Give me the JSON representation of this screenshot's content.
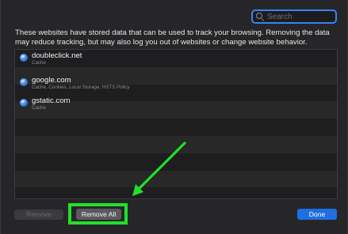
{
  "search": {
    "placeholder": "Search",
    "icon": "magnifying-glass-icon"
  },
  "description": "These websites have stored data that can be used to track your browsing. Removing the data may reduce tracking, but may also log you out of websites or change website behavior.",
  "websites": [
    {
      "domain": "doubleclick.net",
      "data": "Cache",
      "icon": "globe-icon"
    },
    {
      "domain": "google.com",
      "data": "Cache, Cookies, Local Storage, HSTS Policy",
      "icon": "globe-icon"
    },
    {
      "domain": "gstatic.com",
      "data": "Cache",
      "icon": "globe-icon"
    }
  ],
  "buttons": {
    "remove": "Remove",
    "remove_all": "Remove All",
    "done": "Done"
  },
  "annotation": {
    "highlight_color": "#22e02a",
    "target": "remove-all-button"
  },
  "colors": {
    "accent": "#1f6fe0",
    "focus_ring": "#3b82f6"
  }
}
